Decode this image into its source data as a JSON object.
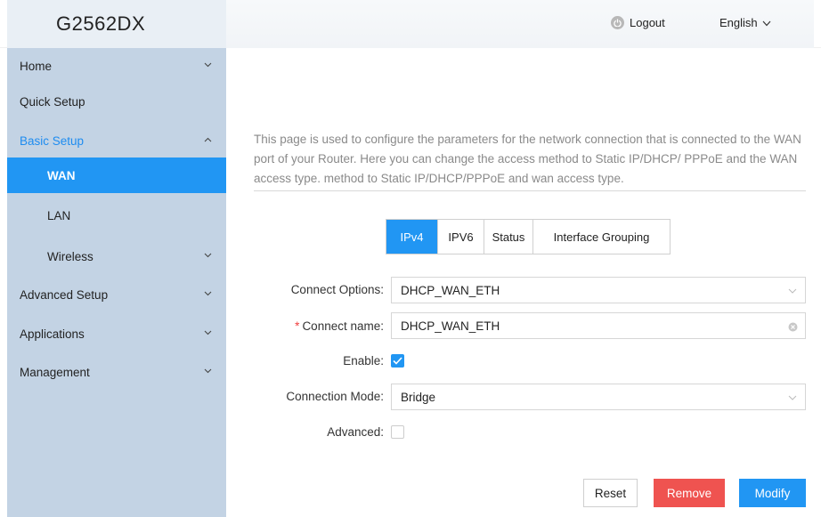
{
  "header": {
    "logo": "G2562DX",
    "logout_label": "Logout",
    "language_label": "English",
    "logout_icon": "logout-icon",
    "language_icon": "chevron-down-icon"
  },
  "sidebar": {
    "items": [
      {
        "label": "Home",
        "icon": "chevron-down-icon"
      },
      {
        "label": "Quick Setup"
      },
      {
        "label": "Basic Setup",
        "icon": "chevron-up-icon"
      },
      {
        "label": "WAN"
      },
      {
        "label": "LAN"
      },
      {
        "label": "Wireless",
        "icon": "chevron-down-icon"
      },
      {
        "label": "Advanced Setup",
        "icon": "chevron-down-icon"
      },
      {
        "label": "Applications",
        "icon": "chevron-down-icon"
      },
      {
        "label": "Management",
        "icon": "chevron-down-icon"
      }
    ],
    "active_item": "WAN",
    "active_parent": "Basic Setup"
  },
  "main": {
    "description": "This page is used to configure the parameters for the network connection that is connected to the WAN port of your Router. Here you can change the access method to Static IP/DHCP/ PPPoE and the WAN access type. method to Static IP/DHCP/PPPoE and wan access type.",
    "tabs": [
      {
        "label": "IPv4"
      },
      {
        "label": "IPV6"
      },
      {
        "label": "Status"
      },
      {
        "label": "Interface Grouping"
      }
    ],
    "active_tab": "IPv4",
    "form": {
      "connect_options": {
        "label": "Connect Options:",
        "value": "DHCP_WAN_ETH"
      },
      "connect_name": {
        "label": "Connect name:",
        "required_mark": "*",
        "value": "DHCP_WAN_ETH"
      },
      "enable": {
        "label": "Enable:",
        "checked": true
      },
      "connection_mode": {
        "label": "Connection Mode:",
        "value": "Bridge"
      },
      "advanced": {
        "label": "Advanced:",
        "checked": false
      }
    },
    "buttons": {
      "reset": "Reset",
      "remove": "Remove",
      "modify": "Modify"
    }
  },
  "colors": {
    "accent": "#2196f3",
    "sidebar_bg": "#c3d3e4",
    "danger": "#ef5350",
    "active_parent_text": "#1e8cf0"
  }
}
